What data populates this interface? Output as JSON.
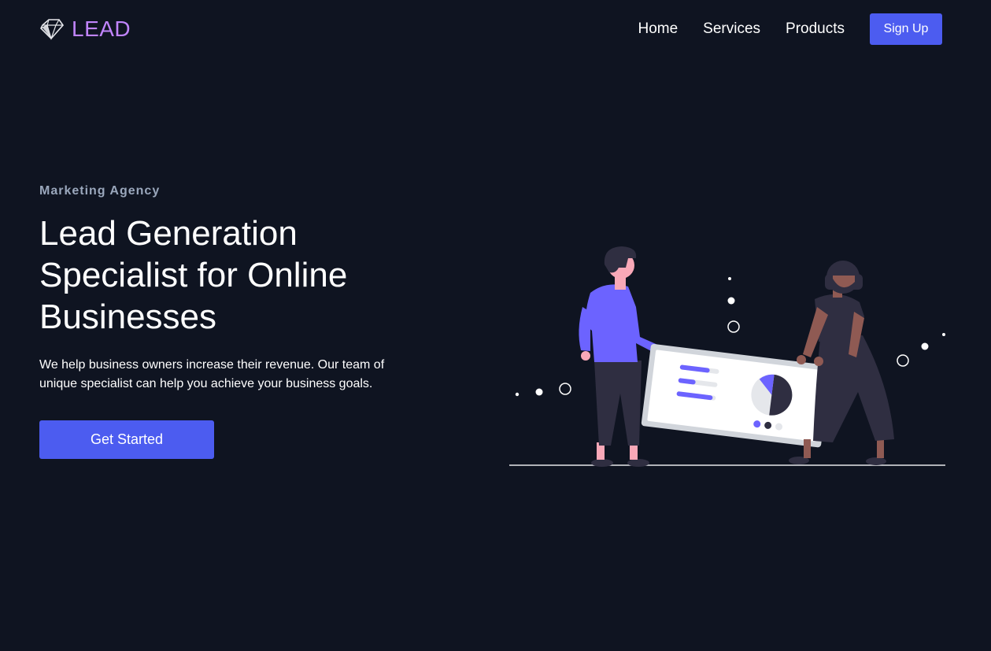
{
  "brand": {
    "name": "LEAD",
    "icon": "diamond-logo-icon",
    "color": "#c084fc"
  },
  "nav": {
    "items": [
      {
        "label": "Home"
      },
      {
        "label": "Services"
      },
      {
        "label": "Products"
      }
    ],
    "signup_label": "Sign Up"
  },
  "hero": {
    "tagline": "Marketing Agency",
    "headline": "Lead Generation Specialist for Online Businesses",
    "description": "We help business owners increase their revenue. Our team of unique specialist can help you achieve your business goals.",
    "cta_label": "Get Started"
  },
  "colors": {
    "background": "#0f1421",
    "accent": "#4c5cf0",
    "illustration_purple": "#6c63ff"
  },
  "illustration": {
    "name": "people-holding-dashboard-board",
    "icon": "analytics-illustration"
  }
}
